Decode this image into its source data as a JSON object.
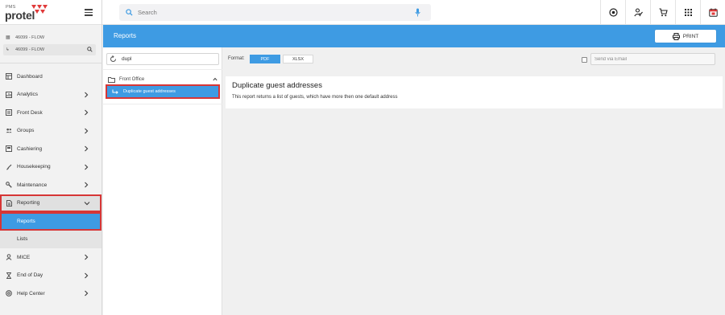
{
  "logo": {
    "small": "PMS",
    "name": "protel"
  },
  "property": {
    "primary": "46099 - FLOW",
    "secondary": "46099 - FLOW"
  },
  "sidebar": {
    "items": [
      {
        "label": "Dashboard",
        "chevron": false
      },
      {
        "label": "Analytics",
        "chevron": true
      },
      {
        "label": "Front Desk",
        "chevron": true
      },
      {
        "label": "Groups",
        "chevron": true
      },
      {
        "label": "Cashiering",
        "chevron": true
      },
      {
        "label": "Housekeeping",
        "chevron": true
      },
      {
        "label": "Maintenance",
        "chevron": true
      },
      {
        "label": "Reporting",
        "chevron": "down",
        "expanded": true
      },
      {
        "label": "Reports",
        "sub": true,
        "selected": true
      },
      {
        "label": "Lists",
        "sub": true
      },
      {
        "label": "MICE",
        "chevron": true
      },
      {
        "label": "End of Day",
        "chevron": true
      },
      {
        "label": "Help Center",
        "chevron": true
      }
    ]
  },
  "search": {
    "placeholder": "Search",
    "value": ""
  },
  "topbar": {
    "icons": [
      "target-icon",
      "person-check-icon",
      "cart-icon",
      "grid-icon",
      "calendar-icon"
    ]
  },
  "header": {
    "title": "Reports",
    "print_label": "PRINT"
  },
  "filter": {
    "value": "dupl"
  },
  "tree": {
    "folder_label": "Front Office",
    "items": [
      {
        "label": "Duplicate guest addresses",
        "selected": true
      }
    ]
  },
  "format": {
    "label": "Format:",
    "options": [
      "PDF",
      "XLSX"
    ],
    "selected": "PDF"
  },
  "email": {
    "placeholder": "Send via Email",
    "checked": false
  },
  "report": {
    "title": "Duplicate guest addresses",
    "description": "This report returns a list of guests, which have more then one default address"
  },
  "colors": {
    "accent": "#3e9be3",
    "highlight_border": "#d73636",
    "logo_red": "#e03a3a"
  }
}
